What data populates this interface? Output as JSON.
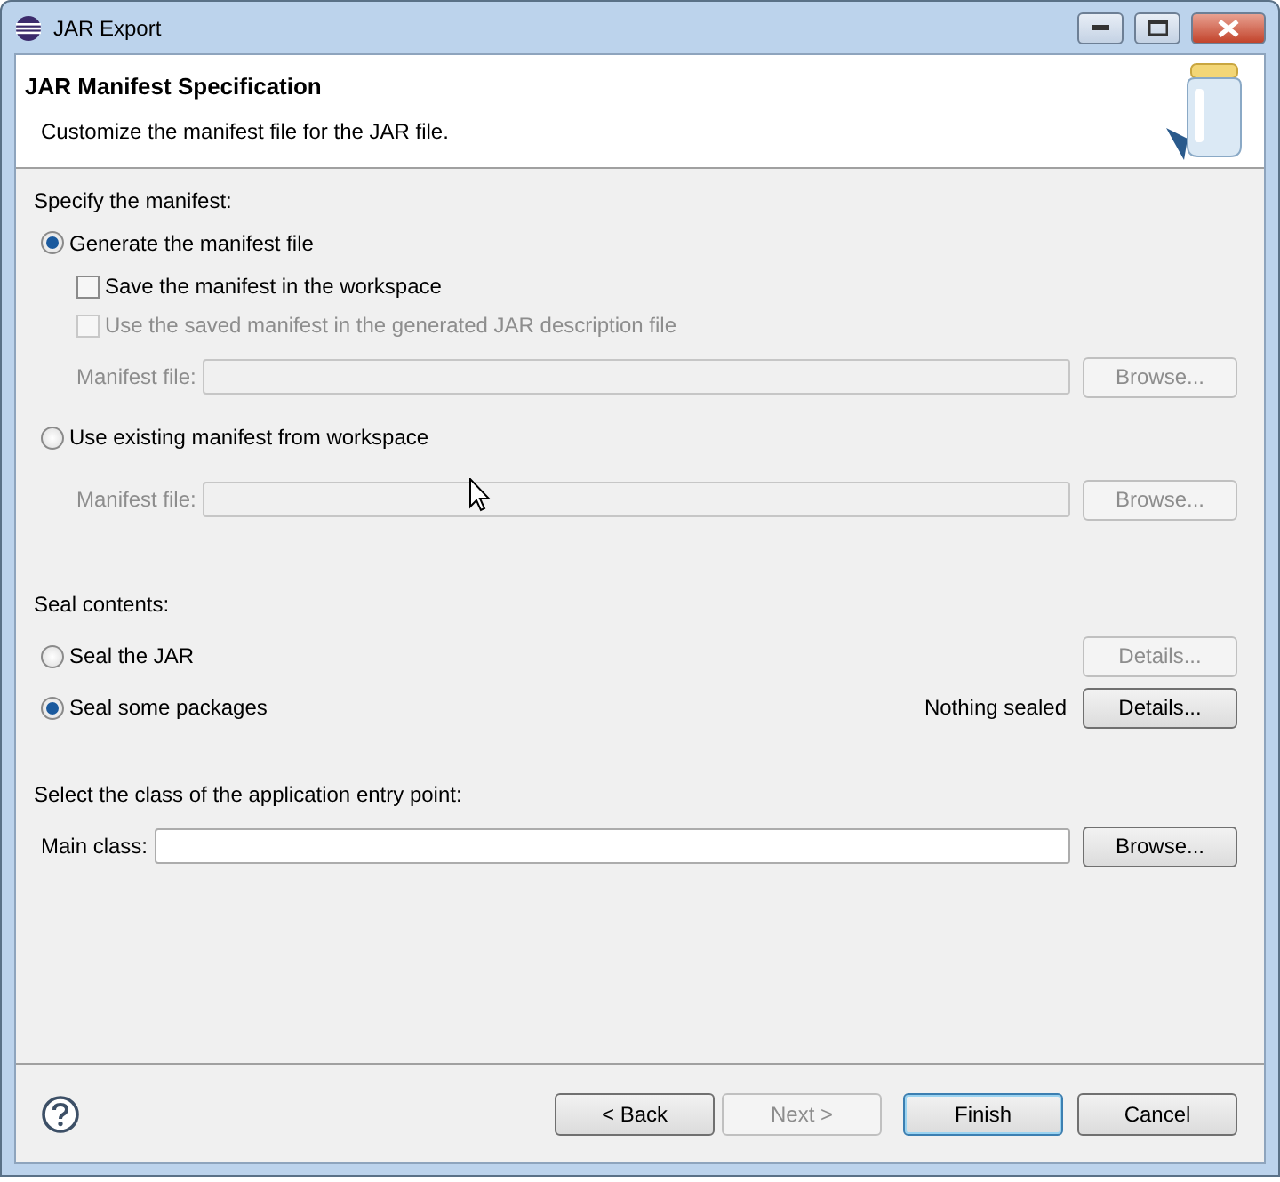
{
  "window": {
    "title": "JAR Export"
  },
  "header": {
    "title": "JAR Manifest Specification",
    "description": "Customize the manifest file for the JAR file."
  },
  "manifest": {
    "heading": "Specify the manifest:",
    "options": [
      {
        "label": "Generate the manifest file",
        "selected": true,
        "checkboxes": [
          {
            "label": "Save the manifest in the workspace",
            "checked": false,
            "disabled": false
          },
          {
            "label": "Use the saved manifest in the generated JAR description file",
            "checked": false,
            "disabled": true
          }
        ],
        "file_field": {
          "label": "Manifest file:",
          "disabled": true,
          "button": {
            "label": "Browse...",
            "disabled": true
          }
        }
      },
      {
        "label": "Use existing manifest from workspace",
        "selected": false,
        "file_field": {
          "label": "Manifest file:",
          "disabled": true,
          "button": {
            "label": "Browse...",
            "disabled": true
          }
        }
      }
    ]
  },
  "seal": {
    "heading": "Seal contents:",
    "options": [
      {
        "label": "Seal the JAR",
        "selected": false,
        "button": {
          "label": "Details...",
          "disabled": true
        }
      },
      {
        "label": "Seal some packages",
        "selected": true,
        "status": "Nothing sealed",
        "button": {
          "label": "Details...",
          "disabled": false
        }
      }
    ]
  },
  "entry_point": {
    "heading": "Select the class of the application entry point:",
    "field_label": "Main class:",
    "button": {
      "label": "Browse...",
      "disabled": false
    }
  },
  "buttons": [
    {
      "label": "< Back",
      "disabled": false,
      "default": false
    },
    {
      "label": "Next >",
      "disabled": true,
      "default": false
    },
    {
      "label": "Finish",
      "disabled": false,
      "default": true
    },
    {
      "label": "Cancel",
      "disabled": false,
      "default": false
    }
  ]
}
